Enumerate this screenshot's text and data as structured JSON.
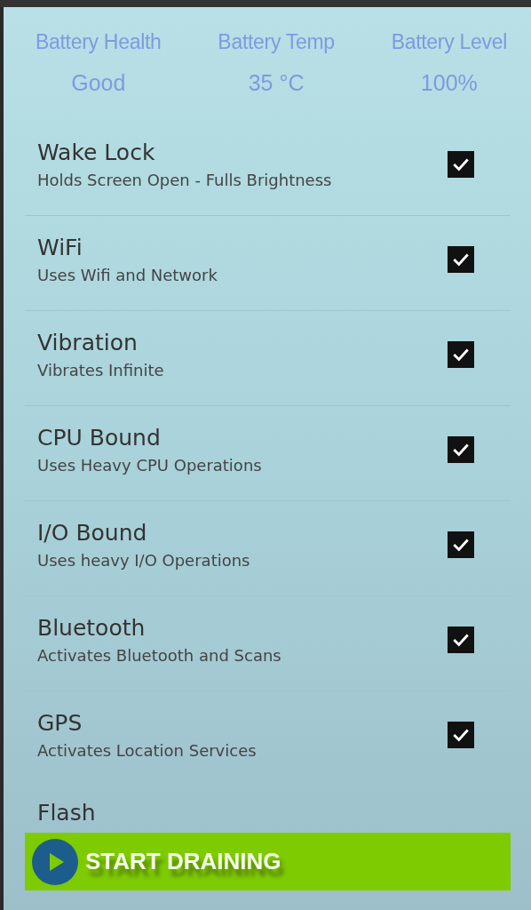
{
  "stats": [
    {
      "label": "Battery Health",
      "value": "Good"
    },
    {
      "label": "Battery Temp",
      "value": "35 °C"
    },
    {
      "label": "Battery Level",
      "value": "100%"
    }
  ],
  "options": [
    {
      "title": "Wake Lock",
      "subtitle": "Holds Screen Open - Fulls Brightness",
      "checked": true
    },
    {
      "title": "WiFi",
      "subtitle": "Uses Wifi and Network",
      "checked": true
    },
    {
      "title": "Vibration",
      "subtitle": "Vibrates Infinite",
      "checked": true
    },
    {
      "title": "CPU Bound",
      "subtitle": "Uses Heavy CPU Operations",
      "checked": true
    },
    {
      "title": "I/O Bound",
      "subtitle": "Uses heavy I/O Operations",
      "checked": true
    },
    {
      "title": "Bluetooth",
      "subtitle": "Activates Bluetooth and Scans",
      "checked": true
    },
    {
      "title": "GPS",
      "subtitle": "Activates Location Services",
      "checked": true
    }
  ],
  "partial_option": {
    "title": "Flash"
  },
  "start_button": {
    "label": "START DRAINING"
  }
}
